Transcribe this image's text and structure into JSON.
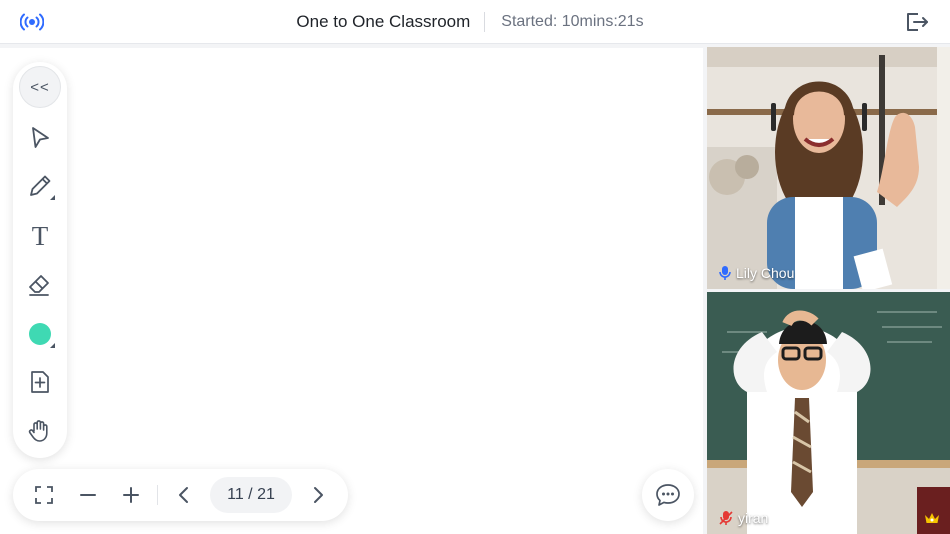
{
  "header": {
    "title": "One to One Classroom",
    "started_label": "Started:",
    "elapsed": "10mins:21s",
    "icons": {
      "left": "live-signal-icon",
      "right": "exit-icon"
    }
  },
  "toolbar": {
    "collapse_label": "<<",
    "tools": [
      "pointer-icon",
      "pencil-icon",
      "text-icon",
      "eraser-icon",
      "color-picker",
      "add-page-icon",
      "hand-icon"
    ],
    "text_tool_glyph": "T",
    "selected_color": "#3fd9b3"
  },
  "bottombar": {
    "page_indicator": "11 / 21",
    "icons": [
      "fullscreen-icon",
      "zoom-out-icon",
      "zoom-in-icon",
      "prev-page-icon",
      "next-page-icon"
    ]
  },
  "chat": {
    "icon": "chat-icon"
  },
  "participants": [
    {
      "name": "Lily Chou",
      "mic": "on",
      "mic_color": "#2f6bff"
    },
    {
      "name": "yiran",
      "mic": "muted",
      "mic_color": "#e53935",
      "badge": "crown-icon",
      "badge_color": "#f5c400"
    }
  ],
  "colors": {
    "accent": "#2f6bff",
    "background": "#f3f4f6"
  }
}
